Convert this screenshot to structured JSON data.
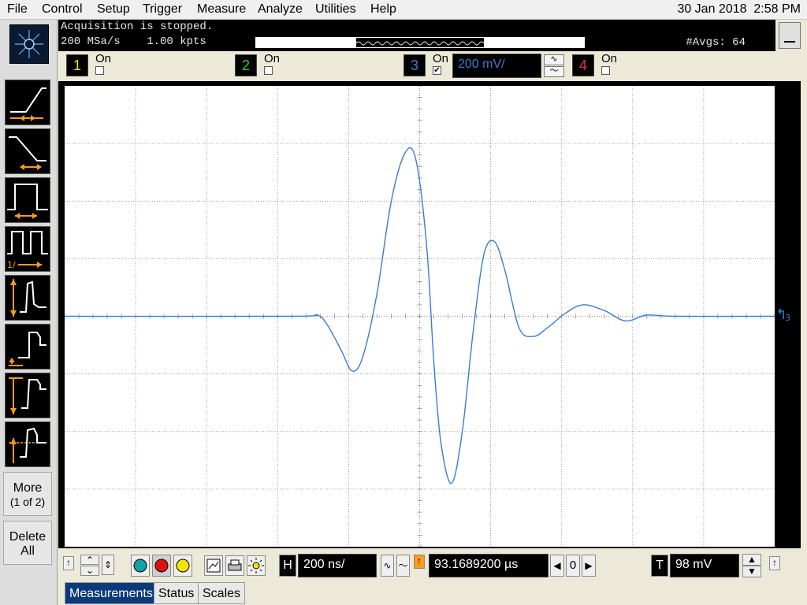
{
  "menu": {
    "items": [
      "File",
      "Control",
      "Setup",
      "Trigger",
      "Measure",
      "Analyze",
      "Utilities",
      "Help"
    ],
    "date": "30 Jan 2018",
    "time": "2:58 PM"
  },
  "status": {
    "line1": "Acquisition is stopped.",
    "line2": "200 MSa/s    1.00 kpts",
    "avgs": "#Avgs: 64"
  },
  "channels": [
    {
      "number": "1",
      "on_label": "On",
      "checked": false,
      "color": "#f2e600"
    },
    {
      "number": "2",
      "on_label": "On",
      "checked": false,
      "color": "#2fd22f"
    },
    {
      "number": "3",
      "on_label": "On",
      "checked": true,
      "color": "#3a7bd5",
      "scale": "200 mV/"
    },
    {
      "number": "4",
      "on_label": "On",
      "checked": false,
      "color": "#e0304a"
    }
  ],
  "sidebar": {
    "more_label_1": "More",
    "more_label_2": "(1 of 2)",
    "delete_label_1": "Delete",
    "delete_label_2": "All",
    "measurement_icons": [
      "rise-time-icon",
      "fall-time-icon",
      "positive-width-icon",
      "frequency-icon",
      "peak-to-peak-icon",
      "minimum-icon",
      "maximum-icon",
      "average-icon"
    ]
  },
  "marker": {
    "label": "3"
  },
  "bottom": {
    "horizontal_label": "H",
    "horizontal_scale": "200 ns/",
    "delay": "93.1689200 µs",
    "delay_ref": "0",
    "trigger_label": "T",
    "trigger_level": "98 mV"
  },
  "tabs": [
    "Measurements",
    "Status",
    "Scales"
  ],
  "colors": {
    "trace": "#3a7bd5",
    "grid": "#8c8c8c",
    "background": "#ffffff"
  },
  "chart_data": {
    "type": "line",
    "xlabel": "",
    "ylabel": "",
    "x_divisions": 10,
    "y_divisions": 8,
    "xlim": [
      0,
      10
    ],
    "ylim": [
      -4,
      4
    ],
    "series": [
      {
        "values_x": [
          0,
          3.2,
          3.55,
          3.7,
          3.9,
          4.05,
          4.2,
          4.4,
          4.6,
          4.8,
          4.95,
          5.1,
          5.2,
          5.3,
          5.45,
          5.6,
          5.75,
          5.9,
          6.05,
          6.2,
          6.4,
          6.6,
          6.8,
          7.05,
          7.3,
          7.6,
          7.9,
          8.2,
          8.6,
          10
        ],
        "values_y": [
          0,
          0,
          0.02,
          -0.15,
          -0.6,
          -0.95,
          -0.7,
          0.4,
          2.0,
          2.85,
          2.7,
          1.2,
          -0.8,
          -2.2,
          -2.9,
          -2.0,
          -0.3,
          1.05,
          1.3,
          0.8,
          -0.2,
          -0.35,
          -0.2,
          0.05,
          0.2,
          0.1,
          -0.08,
          0.02,
          0,
          0
        ]
      }
    ]
  }
}
